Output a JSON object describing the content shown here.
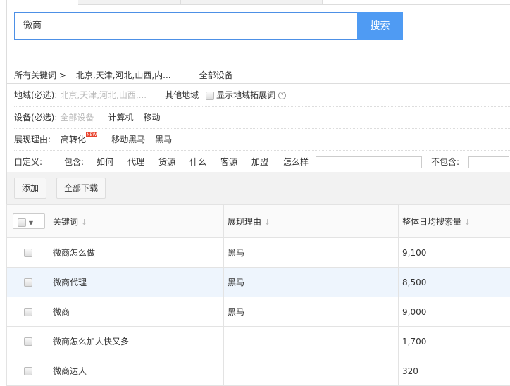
{
  "search": {
    "value": "微商",
    "button": "搜索"
  },
  "breadcrumb": {
    "root": "所有关键词 >",
    "region": "北京,天津,河北,山西,内...",
    "device": "全部设备"
  },
  "filters": {
    "region": {
      "label": "地域(必选):",
      "selected": "北京,天津,河北,山西,...",
      "other": "其他地域",
      "checkbox": "显示地域拓展词"
    },
    "device": {
      "label": "设备(必选):",
      "options": [
        "全部设备",
        "计算机",
        "移动"
      ]
    },
    "reason": {
      "label": "展现理由:",
      "options": [
        "高转化",
        "移动黑马",
        "黑马"
      ],
      "badge": "NEW"
    },
    "custom": {
      "label": "自定义:",
      "include": "包含:",
      "words": [
        "如何",
        "代理",
        "货源",
        "什么",
        "客源",
        "加盟",
        "怎么样"
      ],
      "exclude": "不包含:"
    }
  },
  "toolbar": {
    "add": "添加",
    "download_all": "全部下载"
  },
  "table": {
    "headers": [
      "关键词",
      "展现理由",
      "整体日均搜索量"
    ],
    "rows": [
      {
        "keyword": "微商怎么做",
        "reason": "黑马",
        "volume": "9,100"
      },
      {
        "keyword": "微商代理",
        "reason": "黑马",
        "volume": "8,500"
      },
      {
        "keyword": "微商",
        "reason": "黑马",
        "volume": "9,000"
      },
      {
        "keyword": "微商怎么加人快又多",
        "reason": "",
        "volume": "1,700"
      },
      {
        "keyword": "微商达人",
        "reason": "",
        "volume": "320"
      }
    ]
  }
}
